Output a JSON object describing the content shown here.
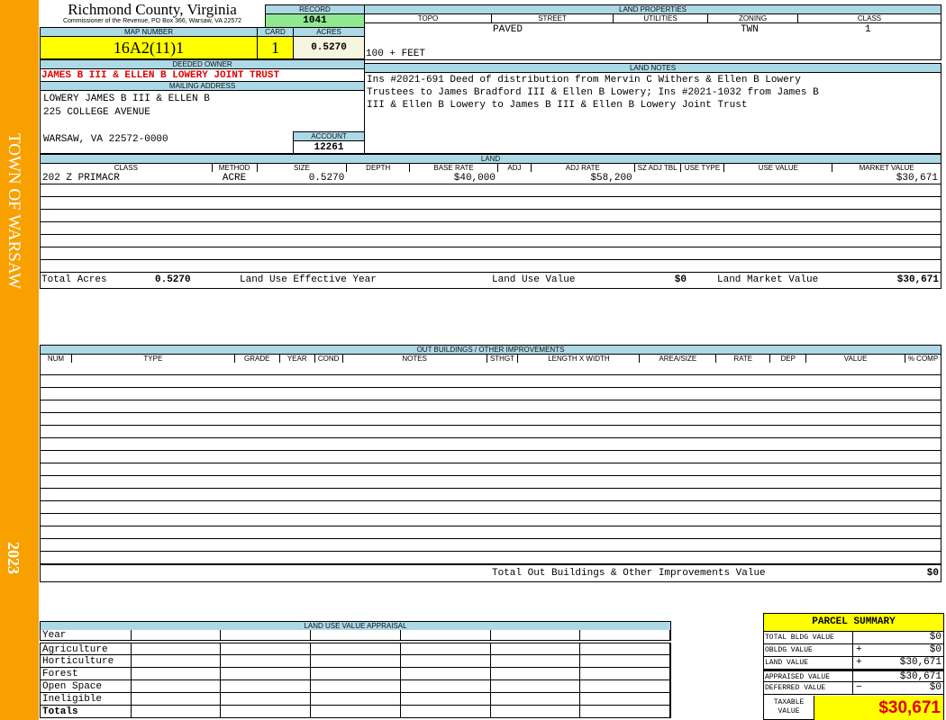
{
  "sidebar": {
    "town": "TOWN OF WARSAW",
    "year": "2023",
    "color": "#f7a000"
  },
  "header": {
    "title": "Richmond County, Virginia",
    "subtitle": "Commissioner of the Revenue, PO Box 366, Warsaw, VA 22572"
  },
  "record": {
    "label": "RECORD",
    "value": "1041"
  },
  "parcel": {
    "map_label": "MAP NUMBER",
    "map_value": "16A2(11)1",
    "card_label": "CARD",
    "card_value": "1",
    "acres_label": "ACRES",
    "acres_value": "0.5270"
  },
  "owner": {
    "label": "DEEDED OWNER",
    "value": "JAMES B III & ELLEN B LOWERY JOINT TRUST"
  },
  "mailing": {
    "label": "MAILING ADDRESS",
    "lines": [
      "LOWERY JAMES B III & ELLEN B",
      "225 COLLEGE AVENUE",
      "",
      "WARSAW, VA 22572-0000"
    ]
  },
  "account": {
    "label": "ACCOUNT",
    "value": "12261"
  },
  "land_properties": {
    "label": "LAND PROPERTIES",
    "columns": [
      "TOPO",
      "STREET",
      "UTILITIES",
      "ZONING",
      "CLASS"
    ],
    "street": "PAVED",
    "zoning": "TWN",
    "class": "1",
    "frontage": "100 + FEET"
  },
  "land_notes": {
    "label": "LAND NOTES",
    "lines": [
      "Ins #2021-691 Deed of distribution from Mervin C Withers & Ellen B Lowery",
      "Trustees to James Bradford III & Ellen B Lowery; Ins #2021-1032 from James B",
      "III & Ellen B Lowery to James B III & Ellen B Lowery Joint Trust"
    ]
  },
  "land": {
    "label": "LAND",
    "columns": [
      "CLASS",
      "METHOD",
      "SIZE",
      "DEPTH",
      "BASE RATE",
      "ADJ",
      "ADJ RATE",
      "SZ ADJ TBL",
      "USE TYPE",
      "USE VALUE",
      "MARKET VALUE"
    ],
    "rows": [
      [
        "202 Z PRIMACR",
        "ACRE",
        "0.5270",
        "",
        "$40,000",
        "",
        "$58,200",
        "",
        "",
        "",
        "$30,671"
      ]
    ],
    "totals": {
      "acres_label": "Total Acres",
      "acres": "0.5270",
      "year_label": "Land Use Effective Year",
      "use_label": "Land Use Value",
      "use_value": "$0",
      "market_label": "Land Market Value",
      "market_value": "$30,671"
    }
  },
  "outbuildings": {
    "label": "OUT BUILDINGS / OTHER IMPROVEMENTS",
    "columns": [
      "NUM",
      "TYPE",
      "GRADE",
      "YEAR",
      "COND",
      "NOTES",
      "STHGT",
      "LENGTH X WIDTH",
      "AREA/SIZE",
      "RATE",
      "DEP",
      "VALUE",
      "% COMP"
    ],
    "total_label": "Total Out Buildings & Other Improvements Value",
    "total_value": "$0"
  },
  "land_use": {
    "label": "LAND USE VALUE APPRAISAL",
    "year_label": "Year",
    "rows": [
      "Agriculture",
      "Horticulture",
      "Forest",
      "Open Space",
      "Ineligible"
    ],
    "totals_label": "Totals"
  },
  "summary": {
    "title": "PARCEL SUMMARY",
    "rows": [
      {
        "label": "TOTAL BLDG VALUE",
        "op": "",
        "value": "$0"
      },
      {
        "label": "OBLDG VALUE",
        "op": "+",
        "value": "$0"
      },
      {
        "label": "LAND VALUE",
        "op": "+",
        "value": "$30,671"
      },
      {
        "label": "APPRAISED VALUE",
        "op": "",
        "value": "$30,671"
      },
      {
        "label": "DEFERRED VALUE",
        "op": "−",
        "value": "$0"
      }
    ],
    "taxable_label": "TAXABLE VALUE",
    "taxable_value": "$30,671"
  }
}
